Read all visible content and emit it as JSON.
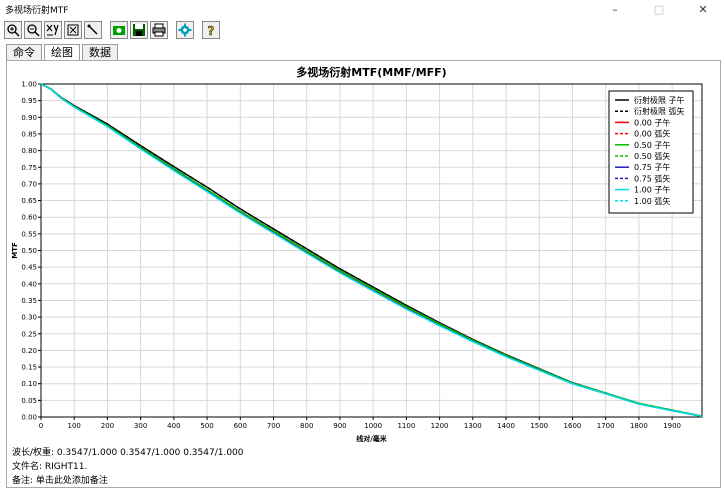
{
  "window": {
    "title": "多视场衍射MTF",
    "minimize": "–",
    "maximize": "□",
    "close": "✕"
  },
  "toolbar": {
    "buttons": [
      {
        "name": "zoom-in-icon",
        "color": "#000"
      },
      {
        "name": "zoom-out-icon",
        "color": "#000"
      },
      {
        "name": "axis-icon",
        "color": "#000"
      },
      {
        "name": "fit-icon",
        "color": "#000"
      },
      {
        "name": "cursor-icon",
        "color": "#000"
      },
      {
        "name": "camera-icon",
        "color": "#00a000"
      },
      {
        "name": "save-icon",
        "color": "#00a000"
      },
      {
        "name": "print-icon",
        "color": "#000"
      },
      {
        "name": "settings-icon",
        "color": "#00a0c0"
      },
      {
        "name": "help-icon",
        "color": "#d0a000"
      }
    ]
  },
  "tabs": [
    {
      "label": "命令",
      "active": false
    },
    {
      "label": "绘图",
      "active": true
    },
    {
      "label": "数据",
      "active": false
    }
  ],
  "footer": {
    "wavelength": "波长/权重:  0.3547/1.000  0.3547/1.000  0.3547/1.000",
    "filename": "文件名:  RIGHT11.",
    "note": "备注:  单击此处添加备注"
  },
  "chart_data": {
    "type": "line",
    "title": "多视场衍射MTF(MMF/MFF)",
    "xlabel": "线对/毫米",
    "ylabel": "MTF",
    "xlim": [
      0,
      1990
    ],
    "ylim": [
      0,
      1.0
    ],
    "xticks": [
      0,
      100,
      200,
      300,
      400,
      500,
      600,
      700,
      800,
      900,
      1000,
      1100,
      1200,
      1300,
      1400,
      1500,
      1600,
      1700,
      1800,
      1900
    ],
    "yticks": [
      0.0,
      0.05,
      0.1,
      0.15,
      0.2,
      0.25,
      0.3,
      0.35,
      0.4,
      0.45,
      0.5,
      0.55,
      0.6,
      0.65,
      0.7,
      0.75,
      0.8,
      0.85,
      0.9,
      0.95,
      1.0
    ],
    "grid": true,
    "legend_position": "top-right",
    "x": [
      0,
      30,
      60,
      100,
      200,
      300,
      400,
      500,
      600,
      700,
      800,
      900,
      1000,
      1100,
      1200,
      1300,
      1400,
      1500,
      1600,
      1700,
      1800,
      1900,
      1990
    ],
    "series": [
      {
        "name": "衍射极限 子午",
        "color": "#000000",
        "dash": false,
        "values": [
          1.0,
          0.985,
          0.96,
          0.935,
          0.88,
          0.815,
          0.752,
          0.69,
          0.625,
          0.565,
          0.505,
          0.445,
          0.39,
          0.335,
          0.283,
          0.233,
          0.187,
          0.145,
          0.103,
          0.072,
          0.04,
          0.02,
          0.002
        ]
      },
      {
        "name": "衍射极限 弧矢",
        "color": "#000000",
        "dash": true,
        "values": [
          1.0,
          0.985,
          0.96,
          0.935,
          0.88,
          0.815,
          0.752,
          0.69,
          0.625,
          0.565,
          0.505,
          0.445,
          0.39,
          0.335,
          0.283,
          0.233,
          0.187,
          0.145,
          0.103,
          0.072,
          0.04,
          0.02,
          0.002
        ]
      },
      {
        "name": "0.00 子午",
        "color": "#ff0000",
        "dash": false,
        "values": [
          1.0,
          0.984,
          0.958,
          0.932,
          0.874,
          0.808,
          0.743,
          0.68,
          0.615,
          0.555,
          0.495,
          0.436,
          0.381,
          0.327,
          0.276,
          0.228,
          0.183,
          0.142,
          0.101,
          0.071,
          0.04,
          0.02,
          0.002
        ]
      },
      {
        "name": "0.00 弧矢",
        "color": "#ff0000",
        "dash": true,
        "values": [
          1.0,
          0.984,
          0.958,
          0.932,
          0.874,
          0.808,
          0.743,
          0.68,
          0.615,
          0.555,
          0.495,
          0.436,
          0.381,
          0.327,
          0.276,
          0.228,
          0.183,
          0.142,
          0.101,
          0.071,
          0.04,
          0.02,
          0.002
        ]
      },
      {
        "name": "0.50 子午",
        "color": "#00c000",
        "dash": false,
        "values": [
          1.0,
          0.985,
          0.959,
          0.933,
          0.876,
          0.81,
          0.746,
          0.683,
          0.618,
          0.559,
          0.499,
          0.44,
          0.385,
          0.331,
          0.28,
          0.231,
          0.185,
          0.144,
          0.102,
          0.072,
          0.041,
          0.021,
          0.003
        ]
      },
      {
        "name": "0.50 弧矢",
        "color": "#00c000",
        "dash": true,
        "values": [
          1.0,
          0.985,
          0.959,
          0.933,
          0.876,
          0.81,
          0.746,
          0.683,
          0.618,
          0.559,
          0.499,
          0.44,
          0.385,
          0.331,
          0.28,
          0.231,
          0.185,
          0.144,
          0.102,
          0.072,
          0.041,
          0.021,
          0.003
        ]
      },
      {
        "name": "0.75 子午",
        "color": "#2020c0",
        "dash": false,
        "values": [
          1.0,
          0.984,
          0.958,
          0.931,
          0.873,
          0.806,
          0.741,
          0.678,
          0.613,
          0.553,
          0.493,
          0.434,
          0.379,
          0.325,
          0.275,
          0.227,
          0.182,
          0.141,
          0.1,
          0.07,
          0.039,
          0.019,
          0.002
        ]
      },
      {
        "name": "0.75 弧矢",
        "color": "#2020c0",
        "dash": true,
        "values": [
          1.0,
          0.984,
          0.958,
          0.931,
          0.873,
          0.806,
          0.741,
          0.678,
          0.613,
          0.553,
          0.493,
          0.434,
          0.379,
          0.325,
          0.275,
          0.227,
          0.182,
          0.141,
          0.1,
          0.07,
          0.039,
          0.019,
          0.002
        ]
      },
      {
        "name": "1.00 子午",
        "color": "#00e0e0",
        "dash": false,
        "values": [
          1.0,
          0.984,
          0.958,
          0.931,
          0.872,
          0.805,
          0.74,
          0.677,
          0.612,
          0.552,
          0.492,
          0.433,
          0.378,
          0.324,
          0.274,
          0.226,
          0.181,
          0.14,
          0.1,
          0.07,
          0.039,
          0.019,
          0.002
        ]
      },
      {
        "name": "1.00 弧矢",
        "color": "#00e0e0",
        "dash": true,
        "values": [
          1.0,
          0.984,
          0.958,
          0.931,
          0.872,
          0.805,
          0.74,
          0.677,
          0.612,
          0.552,
          0.492,
          0.433,
          0.378,
          0.324,
          0.274,
          0.226,
          0.181,
          0.14,
          0.1,
          0.07,
          0.039,
          0.019,
          0.002
        ]
      }
    ]
  }
}
